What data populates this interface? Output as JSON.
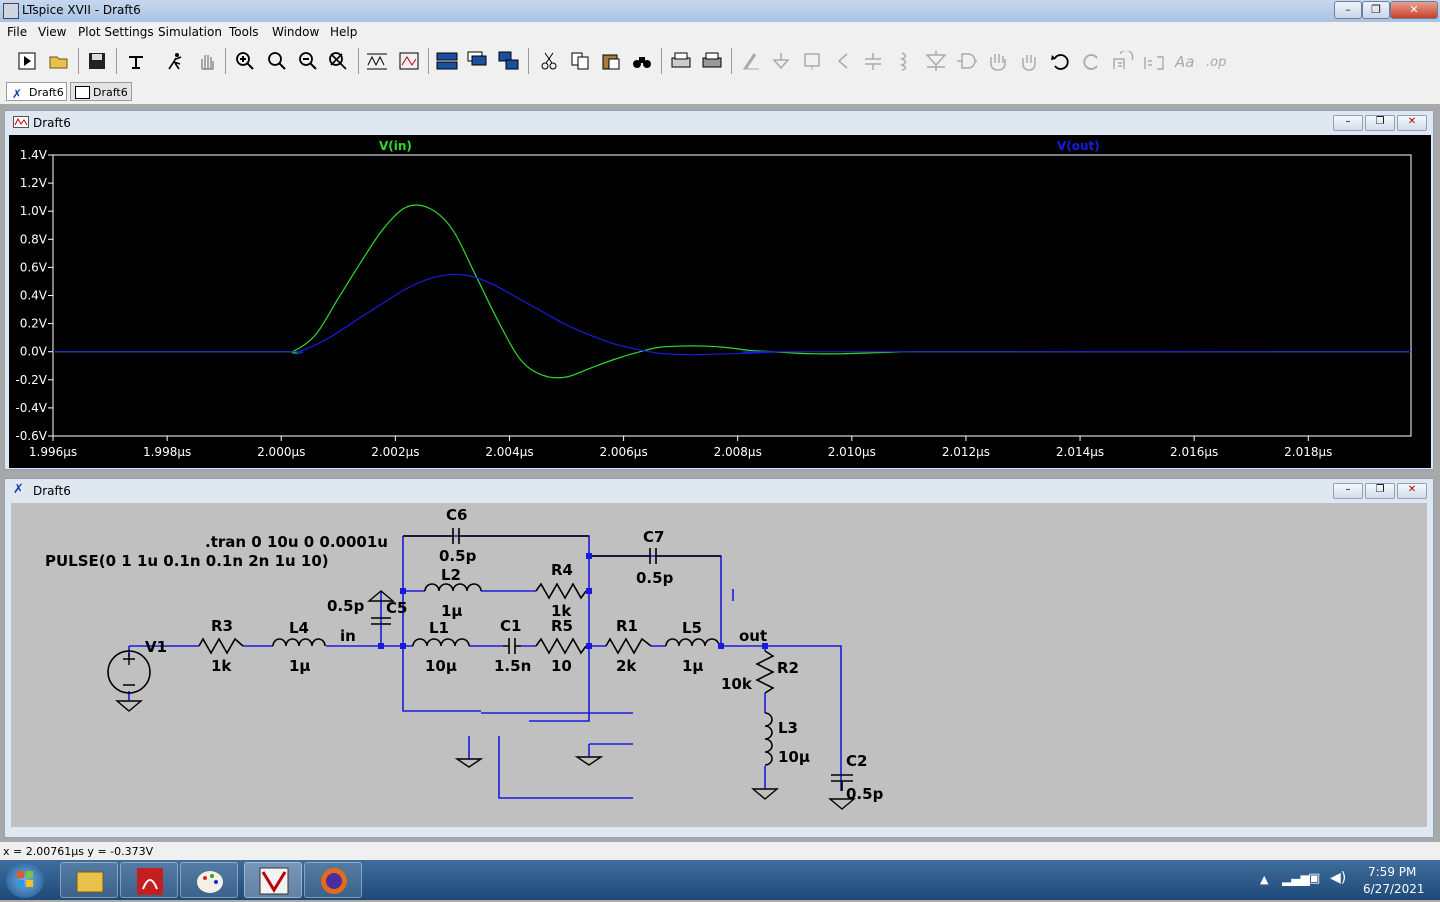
{
  "app": {
    "window_title": "LTspice XVII - Draft6",
    "title_buttons": [
      "–",
      "❐",
      "✕"
    ]
  },
  "menu": [
    "File",
    "View",
    "Plot Settings",
    "Simulation",
    "Tools",
    "Window",
    "Help"
  ],
  "tabs": [
    {
      "label": "Draft6",
      "kind": "schematic",
      "active": true
    },
    {
      "label": "Draft6",
      "kind": "waveform",
      "active": false
    }
  ],
  "waveform_window": {
    "title": "Draft6",
    "buttons": [
      "–",
      "❐",
      "✕"
    ]
  },
  "schematic_window": {
    "title": "Draft6",
    "buttons": [
      "–",
      "❐",
      "✕"
    ]
  },
  "chart_data": {
    "type": "line",
    "background": "#000000",
    "x_unit": "µs",
    "xlim": [
      1.996,
      2.0198
    ],
    "ylim": [
      -0.6,
      1.4
    ],
    "x_tick_labels": [
      "1.996µs",
      "1.998µs",
      "2.000µs",
      "2.002µs",
      "2.004µs",
      "2.006µs",
      "2.008µs",
      "2.010µs",
      "2.012µs",
      "2.014µs",
      "2.016µs",
      "2.018µs"
    ],
    "x_ticks": [
      1.996,
      1.998,
      2.0,
      2.002,
      2.004,
      2.006,
      2.008,
      2.01,
      2.012,
      2.014,
      2.016,
      2.018
    ],
    "y_tick_labels": [
      "1.4V",
      "1.2V",
      "1.0V",
      "0.8V",
      "0.6V",
      "0.4V",
      "0.2V",
      "0.0V",
      "-0.2V",
      "-0.4V",
      "-0.6V"
    ],
    "y_ticks": [
      1.4,
      1.2,
      1.0,
      0.8,
      0.6,
      0.4,
      0.2,
      0.0,
      -0.2,
      -0.4,
      -0.6
    ],
    "grid": false,
    "series": [
      {
        "name": "V(in)",
        "color": "#2ddb2d",
        "x": [
          1.996,
          2.0,
          2.0002,
          2.0006,
          2.001,
          2.0014,
          2.0018,
          2.0022,
          2.0026,
          2.003,
          2.0034,
          2.0038,
          2.0042,
          2.0046,
          2.005,
          2.0054,
          2.0058,
          2.0062,
          2.0066,
          2.007,
          2.0074,
          2.0078,
          2.0082,
          2.0086,
          2.009,
          2.0094,
          2.0098,
          2.0102,
          2.0106,
          2.011,
          2.012,
          2.0136,
          2.015,
          2.0198
        ],
        "y": [
          0.0,
          0.0,
          0.0,
          0.12,
          0.38,
          0.64,
          0.88,
          1.03,
          1.02,
          0.87,
          0.55,
          0.22,
          -0.06,
          -0.17,
          -0.18,
          -0.12,
          -0.06,
          -0.01,
          0.03,
          0.04,
          0.04,
          0.03,
          0.01,
          0.0,
          -0.01,
          -0.015,
          -0.015,
          -0.01,
          -0.005,
          0.0,
          0.0,
          0.0,
          0.0,
          0.0
        ]
      },
      {
        "name": "V(out)",
        "color": "#1a1add",
        "x": [
          1.996,
          2.0,
          2.0003,
          2.0008,
          2.0013,
          2.0018,
          2.0022,
          2.0026,
          2.003,
          2.0034,
          2.0038,
          2.0042,
          2.0046,
          2.005,
          2.0054,
          2.0058,
          2.0062,
          2.0066,
          2.007,
          2.0074,
          2.0078,
          2.0082,
          2.0086,
          2.009,
          2.0198
        ],
        "y": [
          0.0,
          0.0,
          0.0,
          0.09,
          0.22,
          0.35,
          0.45,
          0.52,
          0.55,
          0.53,
          0.46,
          0.37,
          0.28,
          0.19,
          0.12,
          0.06,
          0.02,
          -0.01,
          -0.02,
          -0.02,
          -0.015,
          -0.01,
          -0.005,
          0.0,
          0.0
        ]
      }
    ]
  },
  "schematic": {
    "directives": [
      ".tran 0 10u 0 0.0001u",
      "PULSE(0 1 1u 0.1n 0.1n 2n 1u 10)"
    ],
    "labels": {
      "V1": "V1",
      "R3": "R3",
      "R3_val": "1k",
      "L4": "L4",
      "L4_val": "1µ",
      "C5": "C5",
      "C5_val": "0.5p",
      "in": "in",
      "C6": "C6",
      "C6_val": "0.5p",
      "L2": "L2",
      "L2_val": "1µ",
      "R4": "R4",
      "R4_val": "1k",
      "L1": "L1",
      "L1_val": "10µ",
      "C1": "C1",
      "C1_val": "1.5n",
      "R5": "R5",
      "R5_val": "10",
      "C7": "C7",
      "C7_val": "0.5p",
      "R1": "R1",
      "R1_val": "2k",
      "L5": "L5",
      "L5_val": "1µ",
      "out": "out",
      "R2": "R2",
      "R2_val": "10k",
      "L3": "L3",
      "L3_val": "10µ",
      "C2": "C2",
      "C2_val": "0.5p"
    }
  },
  "status": {
    "cursor": "x = 2.00761µs    y = -0.373V"
  },
  "taskbar": {
    "time": "7:59 PM",
    "date": "6/27/2021"
  }
}
